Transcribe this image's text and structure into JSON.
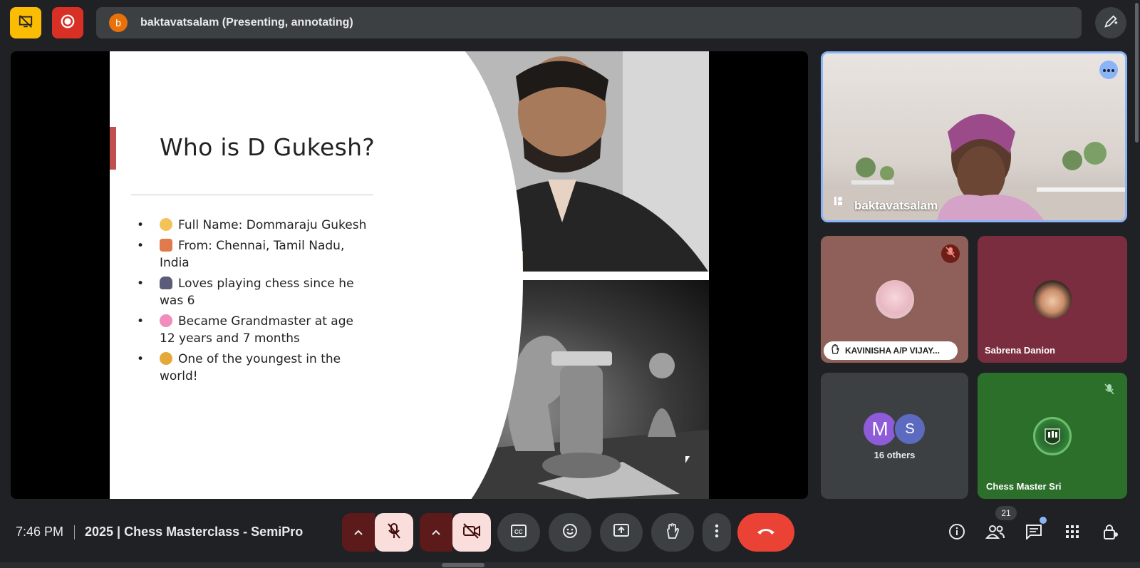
{
  "topbar": {
    "presenter_initial": "b",
    "presenter_text": "baktavatsalam (Presenting, annotating)",
    "icons": [
      "present-off-icon",
      "record-icon",
      "annotate-pen-icon"
    ]
  },
  "slide": {
    "title": "Who is D Gukesh?",
    "bullets": [
      "Full Name: Dommaraju Gukesh",
      "From: Chennai, Tamil Nadu, India",
      "Loves playing chess since he was 6",
      "Became Grandmaster at age 12 years and 7 months",
      "One of the youngest in the world!"
    ],
    "accent_color": "#c0504d"
  },
  "participants": {
    "self": {
      "name": "baktavatsalam"
    },
    "kavinisha": {
      "name": "KAVINISHA A/P VIJAY..."
    },
    "sabrena": {
      "name": "Sabrena Danion"
    },
    "others": {
      "initials": [
        "M",
        "S"
      ],
      "label": "16 others"
    },
    "chessmaster": {
      "name": "Chess Master Sri"
    }
  },
  "bottombar": {
    "time": "7:46 PM",
    "meeting_title": "2025 | Chess Masterclass - SemiPro",
    "people_count": "21",
    "colors": {
      "end_call": "#ea4335",
      "muted_bg": "#f9dedc",
      "accent": "#8ab4f8"
    }
  }
}
